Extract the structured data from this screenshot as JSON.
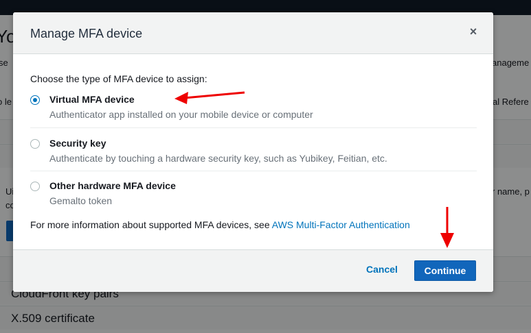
{
  "background": {
    "title_fragment": "Yo",
    "fragments": [
      "se",
      "anageme",
      "o le",
      "al Refere",
      "Ui",
      "r name, p",
      "co"
    ],
    "sections": [
      "CloudFront key pairs",
      "X.509 certificate"
    ]
  },
  "modal": {
    "title": "Manage MFA device",
    "close_symbol": "×",
    "prompt": "Choose the type of MFA device to assign:",
    "options": [
      {
        "label": "Virtual MFA device",
        "description": "Authenticator app installed on your mobile device or computer",
        "checked": true
      },
      {
        "label": "Security key",
        "description": "Authenticate by touching a hardware security key, such as Yubikey, Feitian, etc.",
        "checked": false
      },
      {
        "label": "Other hardware MFA device",
        "description": "Gemalto token",
        "checked": false
      }
    ],
    "info_text": "For more information about supported MFA devices, see ",
    "info_link": "AWS Multi-Factor Authentication",
    "cancel_label": "Cancel",
    "continue_label": "Continue"
  },
  "colors": {
    "accent": "#0073bb",
    "primary_button": "#1166bb",
    "annotation_arrow": "#ee0000"
  }
}
